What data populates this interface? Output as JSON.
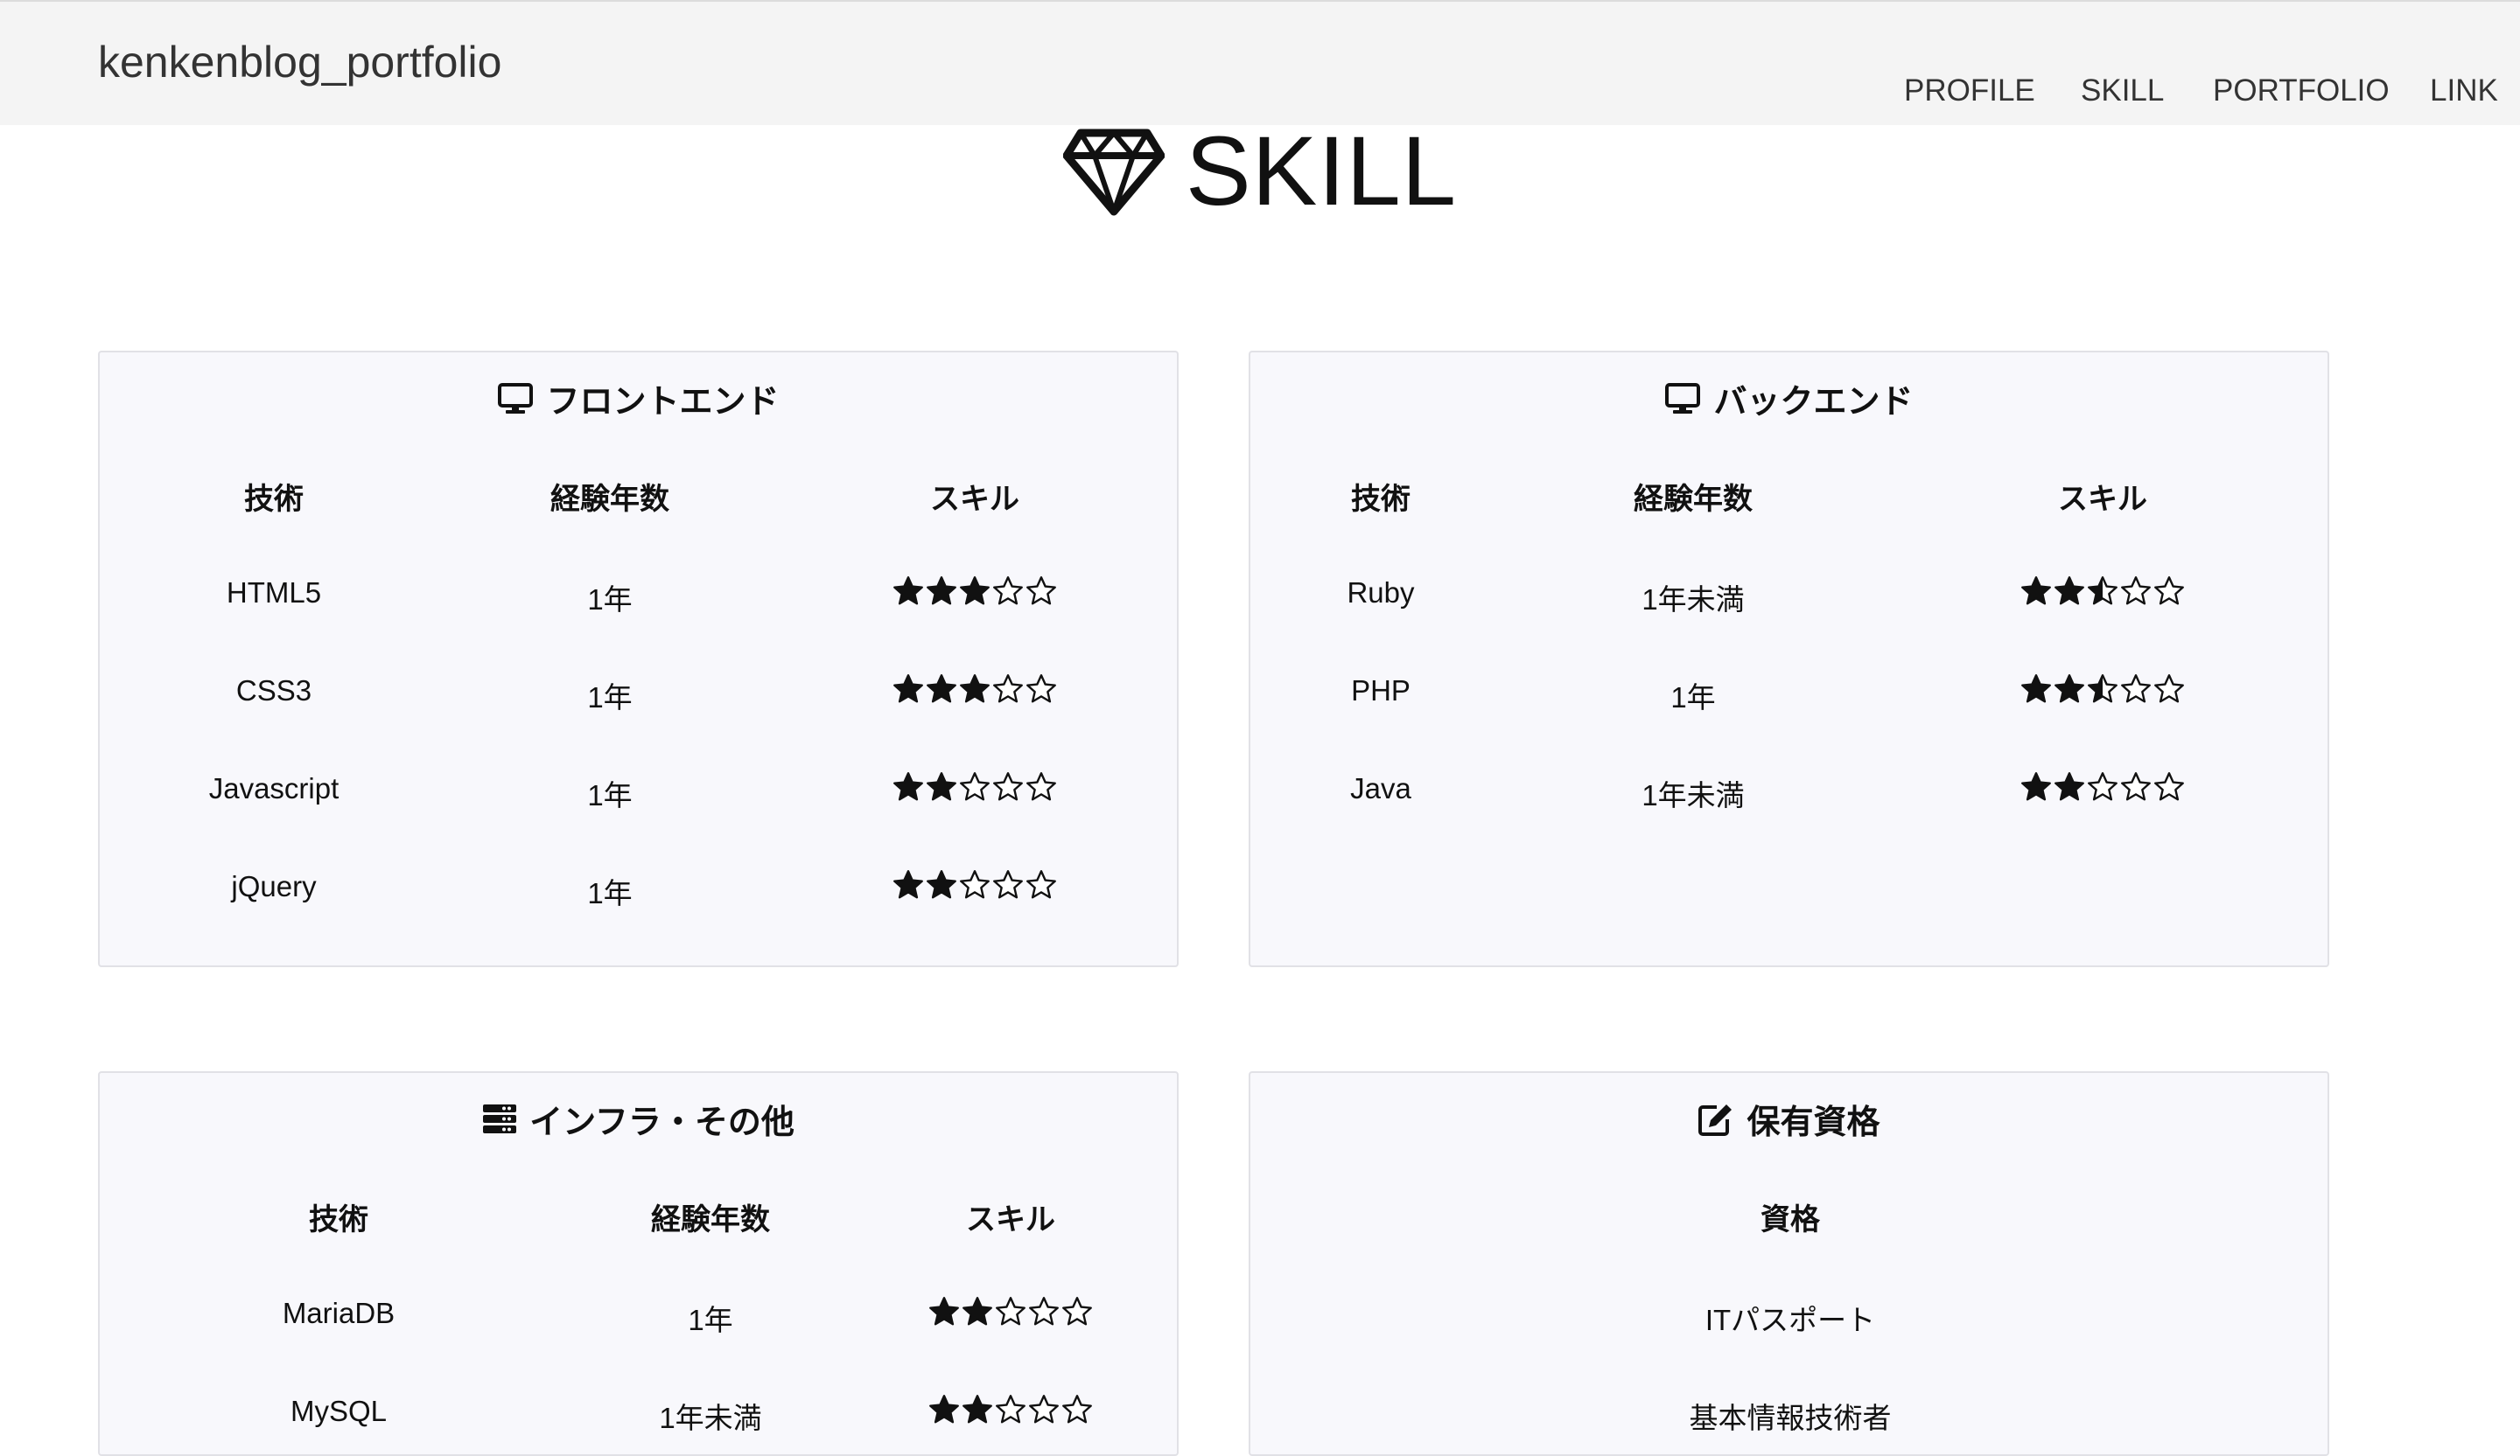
{
  "brand": "kenkenblog_portfolio",
  "nav": [
    {
      "label": "PROFILE"
    },
    {
      "label": "SKILL"
    },
    {
      "label": "PORTFOLIO"
    },
    {
      "label": "LINK"
    }
  ],
  "section": {
    "title": "SKILL",
    "icon": "gem-icon"
  },
  "cards": {
    "frontend": {
      "title": "フロントエンド",
      "icon": "desktop-icon",
      "headers": [
        "技術",
        "経験年数",
        "スキル"
      ],
      "rows": [
        {
          "tech": "HTML5",
          "years": "1年",
          "rating": 3
        },
        {
          "tech": "CSS3",
          "years": "1年",
          "rating": 3
        },
        {
          "tech": "Javascript",
          "years": "1年",
          "rating": 2
        },
        {
          "tech": "jQuery",
          "years": "1年",
          "rating": 2
        }
      ]
    },
    "backend": {
      "title": "バックエンド",
      "icon": "desktop-icon",
      "headers": [
        "技術",
        "経験年数",
        "スキル"
      ],
      "rows": [
        {
          "tech": "Ruby",
          "years": "1年未満",
          "rating": 2.5
        },
        {
          "tech": "PHP",
          "years": "1年",
          "rating": 2.5
        },
        {
          "tech": "Java",
          "years": "1年未満",
          "rating": 2
        }
      ]
    },
    "infra": {
      "title": "インフラ・その他",
      "icon": "server-icon",
      "headers": [
        "技術",
        "経験年数",
        "スキル"
      ],
      "rows": [
        {
          "tech": "MariaDB",
          "years": "1年",
          "rating": 2
        },
        {
          "tech": "MySQL",
          "years": "1年未満",
          "rating": 2
        }
      ]
    },
    "qualifications": {
      "title": "保有資格",
      "icon": "edit-icon",
      "header": "資格",
      "items": [
        "ITパスポート",
        "基本情報技術者"
      ]
    }
  },
  "star_max": 5
}
